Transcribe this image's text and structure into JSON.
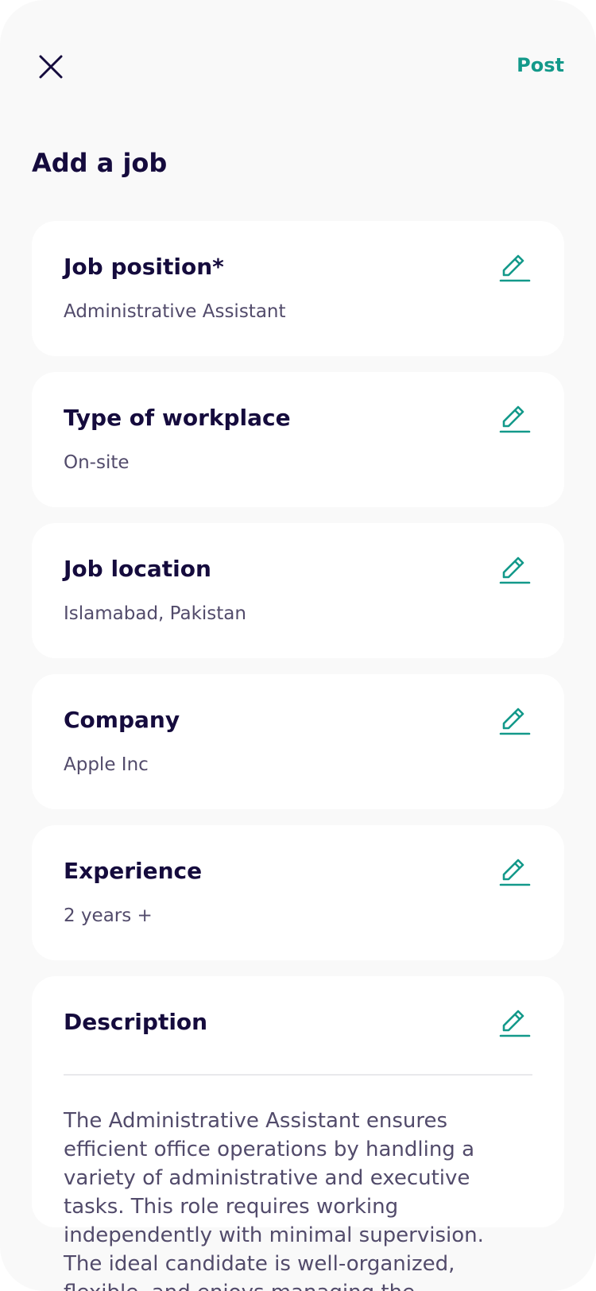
{
  "header": {
    "post_label": "Post",
    "close_icon": "close-icon",
    "accent_color": "#13998a"
  },
  "page": {
    "title": "Add a job"
  },
  "fields": {
    "job_position": {
      "label": "Job position*",
      "value": "Administrative Assistant"
    },
    "workplace": {
      "label": "Type of workplace",
      "value": "On-site"
    },
    "location": {
      "label": "Job location",
      "value": "Islamabad, Pakistan"
    },
    "company": {
      "label": "Company",
      "value": "Apple Inc"
    },
    "experience": {
      "label": "Experience",
      "value": "2 years +"
    },
    "description": {
      "label": "Description",
      "value": "The Administrative Assistant ensures efficient office operations by handling a variety of administrative and executive tasks. This role requires working independently with minimal supervision. The ideal candidate is well-organized, flexible, and enjoys managing the"
    }
  },
  "icons": {
    "edit": "pencil-edit-icon"
  }
}
